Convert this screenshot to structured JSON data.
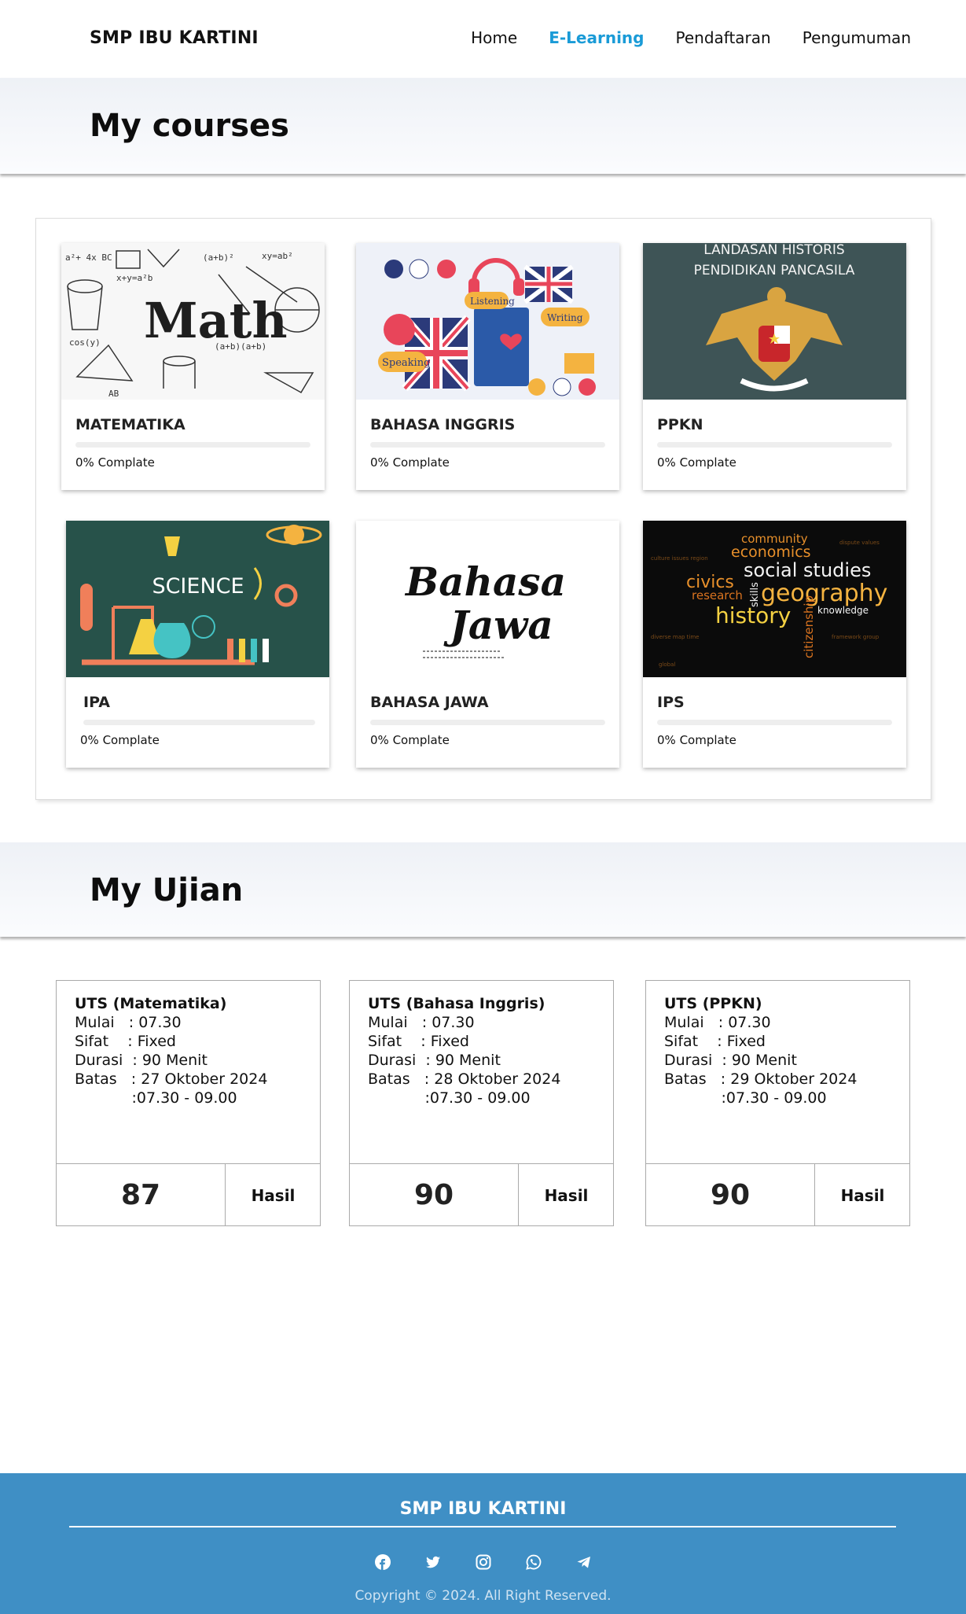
{
  "navbar": {
    "brand": "SMP IBU KARTINI",
    "links": [
      {
        "label": "Home",
        "active": false
      },
      {
        "label": "E-Learning",
        "active": true
      },
      {
        "label": "Pendaftaran",
        "active": false
      },
      {
        "label": "Pengumuman",
        "active": false
      }
    ]
  },
  "courses_section": {
    "title": "My courses",
    "courses": [
      {
        "name": "MATEMATIKA",
        "status": "0% Complate",
        "progress": 0,
        "image": "math-doodle"
      },
      {
        "name": "BAHASA INGGRIS",
        "status": "0% Complate",
        "progress": 0,
        "image": "english-illustration"
      },
      {
        "name": "PPKN",
        "status": "0% Complate",
        "progress": 0,
        "image": "garuda-pancasila",
        "image_text": [
          "LANDASAN HISTORIS",
          "PENDIDIKAN PANCASILA"
        ]
      },
      {
        "name": "IPA",
        "status": "0% Complate",
        "progress": 0,
        "image": "science-lab",
        "image_text": [
          "SCIENCE"
        ]
      },
      {
        "name": "BAHASA JAWA",
        "status": "0% Complate",
        "progress": 0,
        "image": "bahasa-jawa-lettering",
        "image_text": [
          "Bahasa",
          "Jawa"
        ]
      },
      {
        "name": "IPS",
        "status": "0% Complate",
        "progress": 0,
        "image": "social-studies-wordcloud",
        "image_text": [
          "community",
          "economics",
          "social studies",
          "civics",
          "geography",
          "history",
          "research",
          "skills",
          "knowledge",
          "citizenship"
        ]
      }
    ]
  },
  "exam_section": {
    "title": "My Ujian",
    "exams": [
      {
        "title": "UTS (Matematika)",
        "mulai": "Mulai   : 07.30",
        "sifat": "Sifat    : Fixed",
        "durasi": "Durasi  : 90 Menit",
        "batas": "Batas   : 27 Oktober 2024",
        "waktu": "            :07.30 - 09.00",
        "score": "87",
        "button": "Hasil"
      },
      {
        "title": "UTS (Bahasa Inggris)",
        "mulai": "Mulai   : 07.30",
        "sifat": "Sifat    : Fixed",
        "durasi": "Durasi  : 90 Menit",
        "batas": "Batas   : 28 Oktober 2024",
        "waktu": "            :07.30 - 09.00",
        "score": "90",
        "button": "Hasil"
      },
      {
        "title": "UTS (PPKN)",
        "mulai": "Mulai   : 07.30",
        "sifat": "Sifat    : Fixed",
        "durasi": "Durasi  : 90 Menit",
        "batas": "Batas   : 29 Oktober 2024",
        "waktu": "            :07.30 - 09.00",
        "score": "90",
        "button": "Hasil"
      }
    ]
  },
  "footer": {
    "title": "SMP IBU KARTINI",
    "icons": [
      "facebook-icon",
      "twitter-icon",
      "instagram-icon",
      "whatsapp-icon",
      "telegram-icon"
    ],
    "copyright": "Copyright © 2024. All Right Reserved."
  },
  "colors": {
    "accent": "#1a9bd7",
    "footer_bg": "#3f8fc5"
  }
}
